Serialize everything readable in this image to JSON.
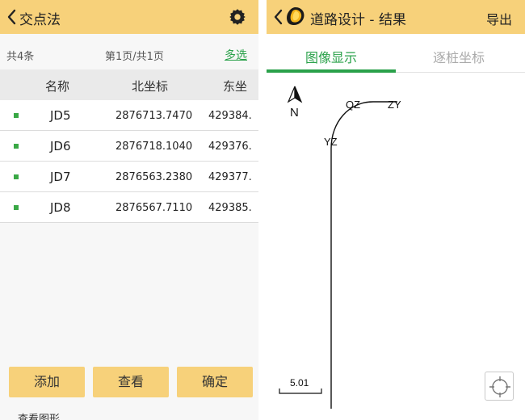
{
  "left": {
    "title": "交点法",
    "count": "共4条",
    "page": "第1页/共1页",
    "multi_select": "多选",
    "headers": [
      "名称",
      "北坐标",
      "东坐"
    ],
    "rows": [
      {
        "name": "JD5",
        "north": "2876713.7470",
        "east": "429384."
      },
      {
        "name": "JD6",
        "north": "2876718.1040",
        "east": "429376."
      },
      {
        "name": "JD7",
        "north": "2876563.2380",
        "east": "429377."
      },
      {
        "name": "JD8",
        "north": "2876567.7110",
        "east": "429385."
      }
    ],
    "buttons": {
      "add": "添加",
      "view": "查看",
      "confirm": "确定"
    },
    "footer": "查看图形"
  },
  "right": {
    "title": "道路设计 - 结果",
    "export": "导出",
    "tabs": {
      "image": "图像显示",
      "stake": "逐桩坐标"
    },
    "drawing": {
      "north": "N",
      "labels": {
        "qz": "QZ",
        "zy": "ZY",
        "yz": "YZ"
      },
      "scale": "5.01"
    }
  },
  "colors": {
    "accent": "#f7d17a",
    "green": "#2aa14a"
  }
}
